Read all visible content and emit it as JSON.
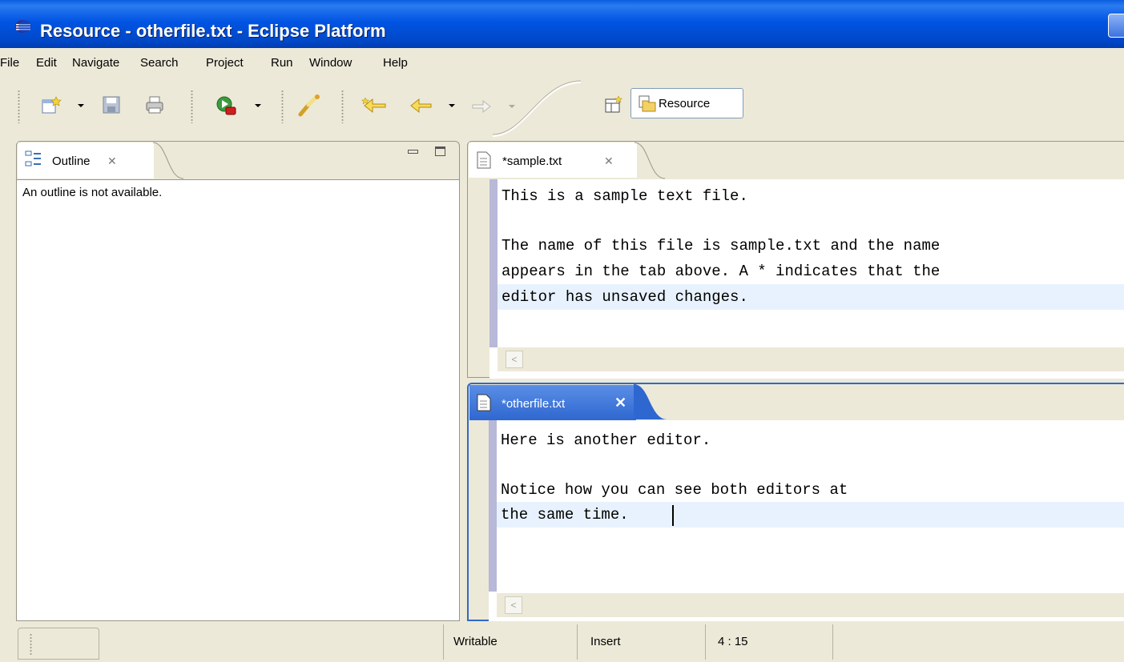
{
  "window": {
    "title": "Resource - otherfile.txt - Eclipse Platform",
    "icon": "eclipse-icon"
  },
  "menu": [
    "File",
    "Edit",
    "Navigate",
    "Search",
    "Project",
    "Run",
    "Window",
    "Help"
  ],
  "toolbar": {
    "icons": [
      "new-wizard-icon",
      "save-icon",
      "print-icon",
      "run-icon",
      "search-icon",
      "last-edit-icon",
      "back-icon",
      "forward-icon",
      "open-perspective-icon"
    ],
    "perspective_label": "Resource"
  },
  "outline": {
    "tab_label": "Outline",
    "message": "An outline is not available."
  },
  "editor1": {
    "tab_label": "*sample.txt",
    "lines": [
      "This is a sample text file.",
      "",
      "The name of this file is sample.txt and the name",
      "appears in the tab above. A * indicates that the",
      "editor has unsaved changes."
    ]
  },
  "editor2": {
    "tab_label": "*otherfile.txt",
    "lines": [
      "Here is another editor.",
      "",
      "Notice how you can see both editors at",
      "the same time."
    ]
  },
  "status": {
    "writable": "Writable",
    "mode": "Insert",
    "position": "4 : 15"
  },
  "colors": {
    "titlebar": "#0054e3",
    "active_border": "#3169c6",
    "current_line": "#e8f2fe",
    "background": "#ece9d8"
  }
}
